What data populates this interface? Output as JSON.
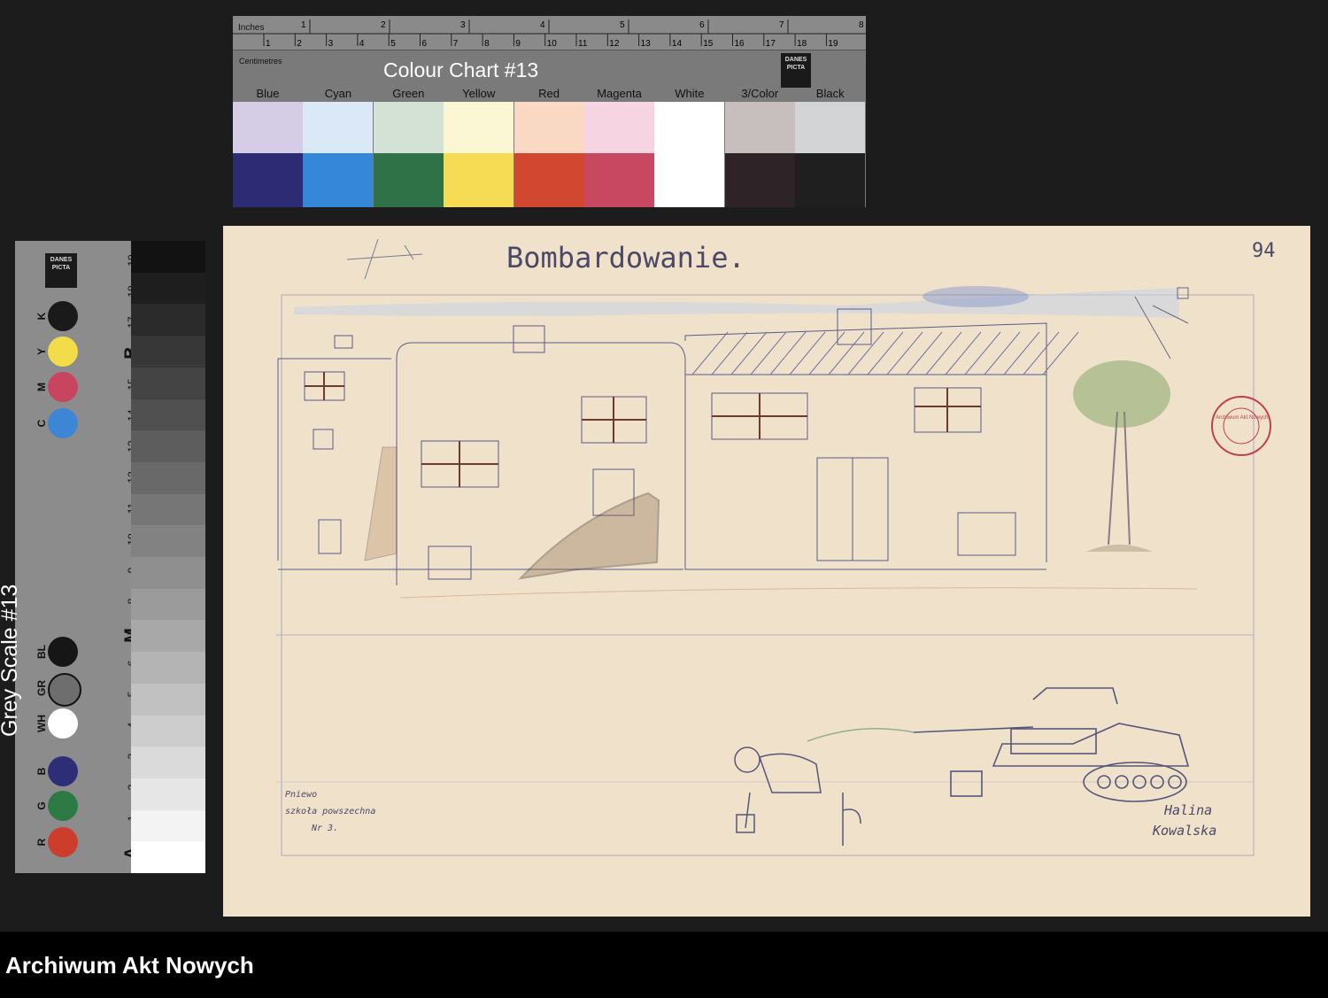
{
  "colour_chart": {
    "title": "Colour Chart #13",
    "inches_label": "Inches",
    "centimetres_label": "Centimetres",
    "inch_marks": [
      "1",
      "2",
      "3",
      "4",
      "5",
      "6",
      "7",
      "8"
    ],
    "cm_marks": [
      "1",
      "2",
      "3",
      "4",
      "5",
      "6",
      "7",
      "8",
      "9",
      "10",
      "11",
      "12",
      "13",
      "14",
      "15",
      "16",
      "17",
      "18",
      "19"
    ],
    "logo_text": "DANES PICTA",
    "swatches": [
      {
        "label": "Blue",
        "light": "#d5cde6",
        "dark": "#2d2b73"
      },
      {
        "label": "Cyan",
        "light": "#dbe8f8",
        "dark": "#3587d9"
      },
      {
        "label": "Green",
        "light": "#d3e2d4",
        "dark": "#2f7247"
      },
      {
        "label": "Yellow",
        "light": "#fbf6d3",
        "dark": "#f6dc55"
      },
      {
        "label": "Red",
        "light": "#f9d9c3",
        "dark": "#d2472f"
      },
      {
        "label": "Magenta",
        "light": "#f6d4e2",
        "dark": "#c84862"
      },
      {
        "label": "White",
        "light": "#ffffff",
        "dark": "#ffffff"
      },
      {
        "label": "3/Color",
        "light": "#c7bebe",
        "dark": "#2e2326"
      },
      {
        "label": "Black",
        "light": "#d3d4d6",
        "dark": "#1f1f1f"
      }
    ]
  },
  "grey_scale": {
    "title": "Grey Scale #13",
    "logo_text": "DANES PICTA",
    "letter_marks": [
      "A",
      "M",
      "B"
    ],
    "cm_marks": [
      "1",
      "2",
      "3",
      "4",
      "5",
      "6",
      "7",
      "8",
      "9",
      "10",
      "11",
      "12",
      "13",
      "14",
      "15",
      "16",
      "17",
      "18",
      "19"
    ],
    "patches": [
      {
        "label": "K",
        "color": "#1a1a1a"
      },
      {
        "label": "Y",
        "color": "#f2dc4a"
      },
      {
        "label": "M",
        "color": "#c9445f"
      },
      {
        "label": "C",
        "color": "#3d86d6"
      },
      {
        "label": "BL",
        "color": "#161616"
      },
      {
        "label": "GR",
        "color": "#6e6e6e"
      },
      {
        "label": "WH",
        "color": "#ffffff"
      },
      {
        "label": "B",
        "color": "#2e2e78"
      },
      {
        "label": "G",
        "color": "#2e7a45"
      },
      {
        "label": "R",
        "color": "#cc3d2c"
      }
    ]
  },
  "drawing": {
    "title": "Bombardowanie.",
    "page_number": "94",
    "school_note": [
      "Pniewo",
      "szkoła powszechna",
      "Nr 3."
    ],
    "author": [
      "Halina",
      "Kowalska"
    ],
    "stamp_text": "Archiwum Akt Nowych"
  },
  "footer": {
    "label": "Archiwum Akt Nowych"
  }
}
